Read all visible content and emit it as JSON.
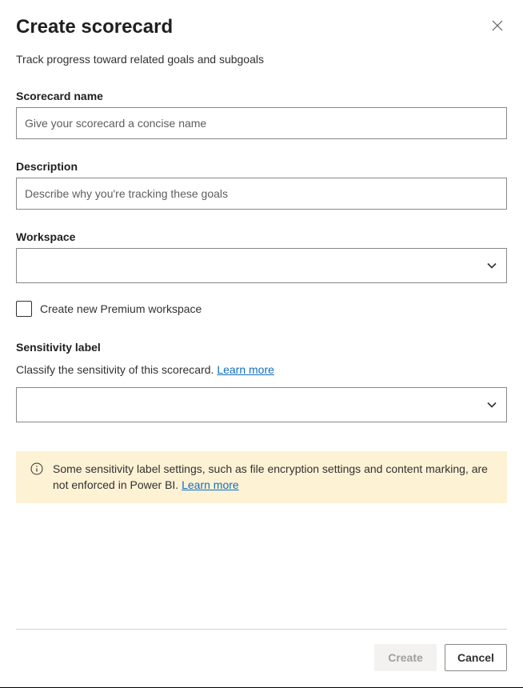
{
  "header": {
    "title": "Create scorecard",
    "subtitle": "Track progress toward related goals and subgoals"
  },
  "fields": {
    "name": {
      "label": "Scorecard name",
      "placeholder": "Give your scorecard a concise name",
      "value": ""
    },
    "description": {
      "label": "Description",
      "placeholder": "Describe why you're tracking these goals",
      "value": ""
    },
    "workspace": {
      "label": "Workspace",
      "value": ""
    },
    "newWorkspace": {
      "label": "Create new Premium workspace"
    },
    "sensitivity": {
      "label": "Sensitivity label",
      "helper_prefix": "Classify the sensitivity of this scorecard. ",
      "learn_more": "Learn more",
      "value": ""
    }
  },
  "infoBox": {
    "text_prefix": "Some sensitivity label settings, such as file encryption settings and content marking, are not enforced in Power BI. ",
    "learn_more": "Learn more"
  },
  "footer": {
    "create": "Create",
    "cancel": "Cancel"
  }
}
